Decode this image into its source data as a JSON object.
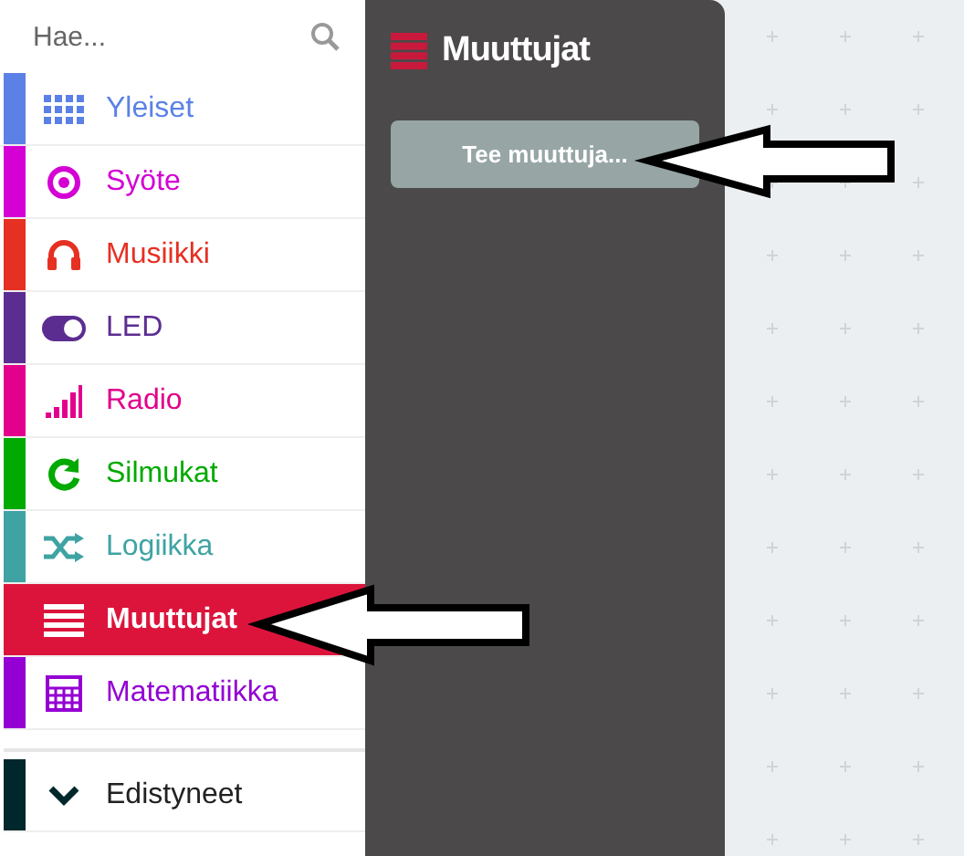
{
  "search": {
    "placeholder": "Hae..."
  },
  "categories": [
    {
      "label": "Yleiset",
      "color": "#5c81e6",
      "selected": false
    },
    {
      "label": "Syöte",
      "color": "#d400d4",
      "selected": false
    },
    {
      "label": "Musiikki",
      "color": "#e63022",
      "selected": false
    },
    {
      "label": "LED",
      "color": "#5c2d91",
      "selected": false
    },
    {
      "label": "Radio",
      "color": "#e3008c",
      "selected": false
    },
    {
      "label": "Silmukat",
      "color": "#00aa00",
      "selected": false
    },
    {
      "label": "Logiikka",
      "color": "#3fa3a3",
      "selected": false
    },
    {
      "label": "Muuttujat",
      "color": "#dc143c",
      "selected": true
    },
    {
      "label": "Matematiikka",
      "color": "#9400d3",
      "selected": false
    }
  ],
  "advanced": {
    "label": "Edistyneet",
    "color": "#00272b"
  },
  "flyout": {
    "title": "Muuttujat",
    "color": "#c8193c",
    "button": "Tee muuttuja..."
  }
}
